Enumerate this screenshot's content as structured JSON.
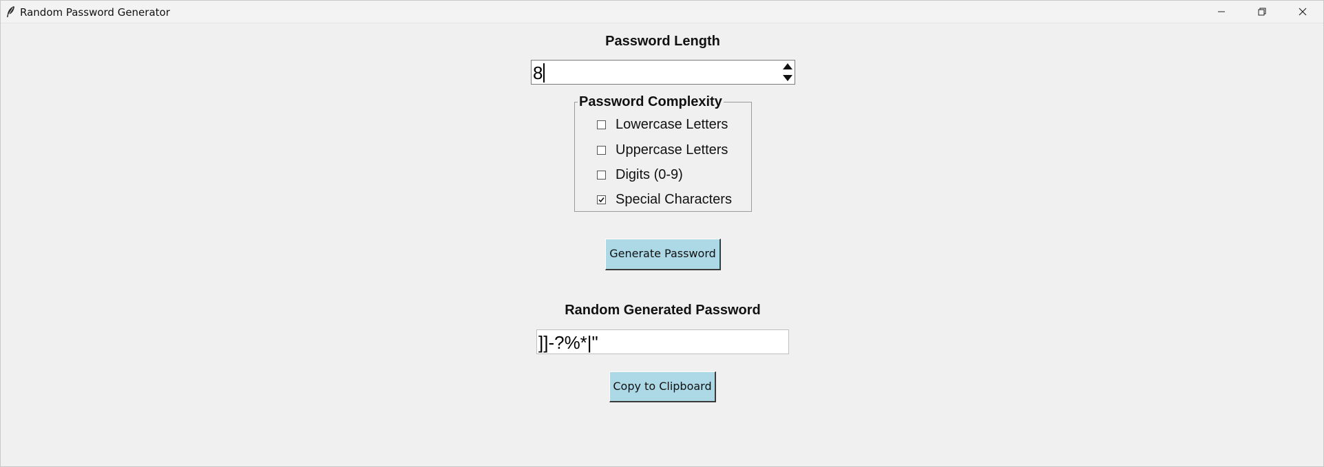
{
  "window": {
    "title": "Random Password Generator",
    "controls": {
      "minimize_icon": "minimize-icon",
      "restore_icon": "restore-icon",
      "close_icon": "close-icon"
    }
  },
  "length_section": {
    "title": "Password Length",
    "value": "8"
  },
  "complexity": {
    "legend": "Password Complexity",
    "options": [
      {
        "label": "Lowercase Letters",
        "checked": false
      },
      {
        "label": "Uppercase Letters",
        "checked": false
      },
      {
        "label": "Digits (0-9)",
        "checked": false
      },
      {
        "label": "Special Characters",
        "checked": true
      }
    ]
  },
  "generate_button": {
    "label": "Generate Password"
  },
  "result_section": {
    "title": "Random Generated Password",
    "value": "]]-?%*|\""
  },
  "copy_button": {
    "label": "Copy to Clipboard"
  },
  "colors": {
    "button_bg": "#add8e6",
    "window_bg": "#f0f0f0"
  }
}
